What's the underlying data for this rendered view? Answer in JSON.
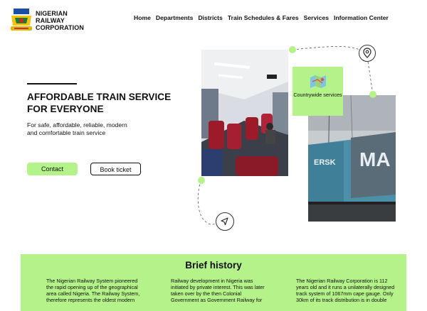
{
  "header": {
    "brand_line1": "NIGERIAN",
    "brand_line2": "RAILWAY",
    "brand_line3": "CORPORATION",
    "nav": [
      "Home",
      "Departments",
      "Districts",
      "Train Schedules & Fares",
      "Services",
      "Information Center"
    ]
  },
  "hero": {
    "title": "AFFORDABLE TRAIN SERVICE FOR EVERYONE",
    "subtitle": "For safe, affordable, reliable, modern and comfortable train service",
    "contact_label": "Contact",
    "book_label": "Book ticket"
  },
  "feature_card": {
    "label": "Countrywide services",
    "icon": "map-icon"
  },
  "colors": {
    "accent": "#b4f28a",
    "text": "#111111"
  },
  "history": {
    "title": "Brief history",
    "col1": "The Nigerian Railway System pioneered the rapid opening up of the geographical area called Nigeria. The Railway System, therefore represents the oldest modern",
    "col2": "Railway development in Nigeria was initiated by private interest. This was later taken over by the then Colonial Government as Government Railway for",
    "col3": "The Nigerian Railway Corporation is 112 years old and it runs a unilaterally designed track system of 1067mm cape gauge. Only 30km of its track distribution is in double"
  }
}
